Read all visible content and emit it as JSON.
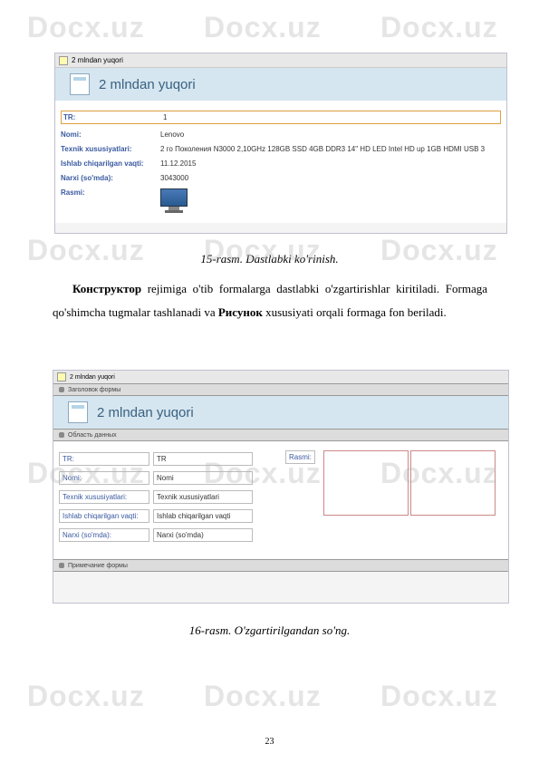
{
  "watermark": "Docx.uz",
  "screenshot1": {
    "tab_title": "2 mlndan yuqori",
    "header_title": "2 mlndan yuqori",
    "fields": {
      "tr_label": "TR:",
      "tr_value": "1",
      "nomi_label": "Nomi:",
      "nomi_value": "Lenovo",
      "texnik_label": "Texnik xususiyatlari:",
      "texnik_value": "2 го Поколения N3000 2,10GHz 128GB SSD 4GB DDR3 14\" HD LED Intel HD up 1GB HDMI USB 3",
      "ishlab_label": "Ishlab chiqarilgan vaqti:",
      "ishlab_value": "11.12.2015",
      "narxi_label": "Narxi (so'mda):",
      "narxi_value": "3043000",
      "rasmi_label": "Rasmi:"
    }
  },
  "caption1": "15-rasm. Dastlabki ko'rinish.",
  "body_text": {
    "word1": "Конструктор",
    "seg1": " rejimiga o'tib formalarga dastlabki o'zgartirishlar kiritiladi. Formaga qo'shimcha tugmalar tashlanadi va ",
    "word2": "Рисунок",
    "seg2": " xususiyati orqali formaga fon beriladi."
  },
  "screenshot2": {
    "tab_title": "2 mlndan yuqori",
    "section1": "Заголовок формы",
    "header_title": "2 mlndan yuqori",
    "section2": "Область данных",
    "fields": {
      "tr_label": "TR:",
      "tr_ctrl": "TR",
      "nomi_label": "Nomi:",
      "nomi_ctrl": "Nomi",
      "texnik_label": "Texnik xususiyatlari:",
      "texnik_ctrl": "Texnik xususiyatlari",
      "ishlab_label": "Ishlab chiqarilgan vaqti:",
      "ishlab_ctrl": "Ishlab chiqarilgan vaqti",
      "narxi_label": "Narxi (so'mda):",
      "narxi_ctrl": "Narxi (so'mda)",
      "rasmi_label": "Rasmi:"
    },
    "section3": "Примечание формы"
  },
  "caption2": "16-rasm. O'zgartirilgandan so'ng.",
  "page_number": "23"
}
